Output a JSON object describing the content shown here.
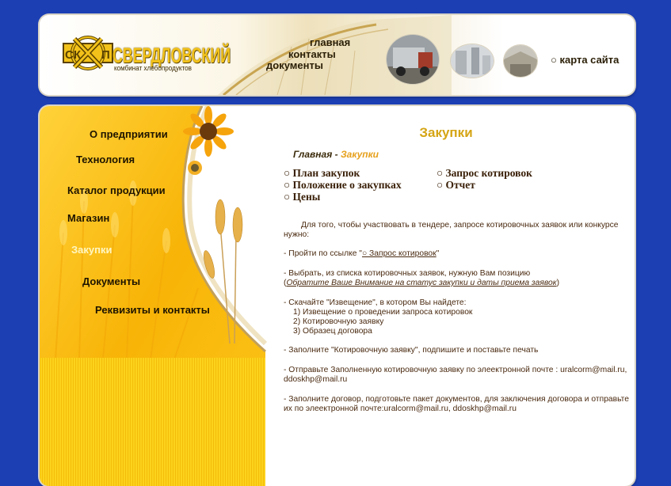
{
  "header": {
    "logo_text": "СВЕРДЛОВСКИЙ",
    "logo_subtitle": "комбинат хлебопродуктов",
    "nav": [
      "главная",
      "контакты",
      "документы"
    ],
    "sitemap": "○ карта сайта",
    "photo_icons": [
      "truck-photo-icon",
      "mill-photo-icon",
      "warehouse-photo-icon"
    ]
  },
  "sidebar": {
    "items": [
      "О предприятии",
      "Технология",
      "Каталог продукции",
      "Магазин",
      "Закупки",
      "Документы",
      "Реквизиты и контакты"
    ],
    "active_index": 4
  },
  "content": {
    "title": "Закупки",
    "breadcrumb_home": "Главная",
    "breadcrumb_sep": " - ",
    "breadcrumb_current": "Закупки",
    "sub_links": [
      "○ План закупок",
      "○ Запрос котировок",
      "○ Положение о закупках",
      "○ Отчет",
      "○ Цены"
    ],
    "intro": "Для того, чтобы участвовать в тендере, запросе котировочных заявок или конкурсе нужно:",
    "step1_prefix": "- Пройти по ссылке \"",
    "step1_link": "○ Запрос котировок",
    "step1_suffix": "\"",
    "step2_line1": "- Выбрать, из списка котировочных заявок, нужную Вам позицию",
    "step2_open": "(",
    "step2_note": "Обратите Ваше Внимание на статус закупки и даты приема заявок",
    "step2_close": ")",
    "step3_line1": "- Скачайте \"Извещение\", в котором Вы найдете:",
    "step3_items": [
      "1) Извещение о проведении запроса котировок",
      "2) Котировочную заявку",
      "3) Образец договора"
    ],
    "step4": "- Заполните \"Котировочную заявку\", подпишите и поставьте печать",
    "step5_line1": "- Отправьте Заполненную котировочную заявку по элеектронной почте : uralcorm@mail.ru,",
    "step5_line2": "ddoskhp@mail.ru",
    "step6_line1": "- Заполните договор, подготовьте пакет документов, для заключения договора и отправьте",
    "step6_line2": "их по элеектронной почте:uralcorm@mail.ru, ddoskhp@mail.ru"
  },
  "colors": {
    "background": "#1c3fb4",
    "accent_gold": "#d5a515",
    "sidebar_yellow": "#fbc40f",
    "text_brown": "#4a2a10"
  }
}
